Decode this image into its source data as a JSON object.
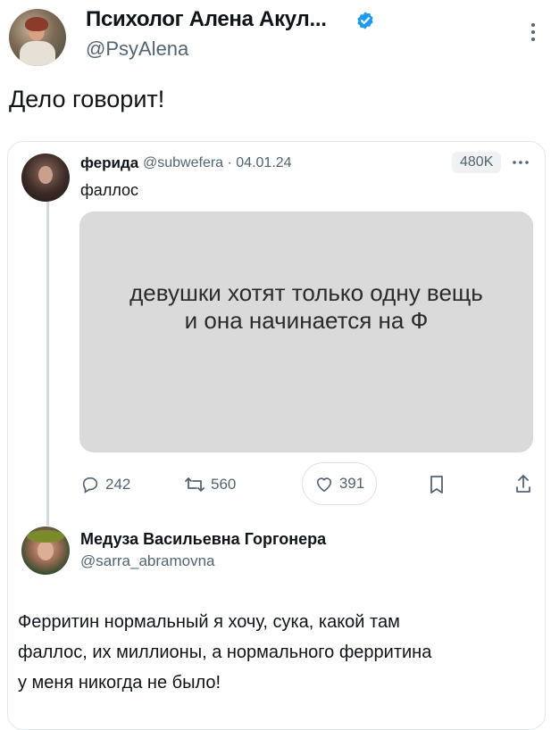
{
  "post": {
    "author_name": "Психолог Алена Акул...",
    "author_handle": "@PsyAlena",
    "text": "Дело говорит!"
  },
  "quoted": {
    "author_name": "ферида",
    "author_handle": "@subwefera · 04.01.24",
    "views": "480K",
    "text": "фаллос",
    "image_text_line1": "девушки хотят только одну вещь",
    "image_text_line2": "и она начинается на Ф",
    "replies": "242",
    "retweets": "560",
    "likes": "391"
  },
  "reply": {
    "author_name": "Медуза Васильевна Горгонера",
    "author_handle": "@sarra_abramovna",
    "text_lines": [
      "Ферритин нормальный я хочу, сука, какой там",
      "фаллос, их миллионы, а нормального ферритина",
      "у меня никогда не было!"
    ]
  },
  "colors": {
    "verified": "#1d9bf0",
    "secondary_text": "#536471",
    "image_background": "#dadada"
  },
  "icons": [
    "verified-badge-icon",
    "more-icon",
    "reply-icon",
    "retweet-icon",
    "like-icon",
    "bookmark-icon",
    "share-icon"
  ]
}
